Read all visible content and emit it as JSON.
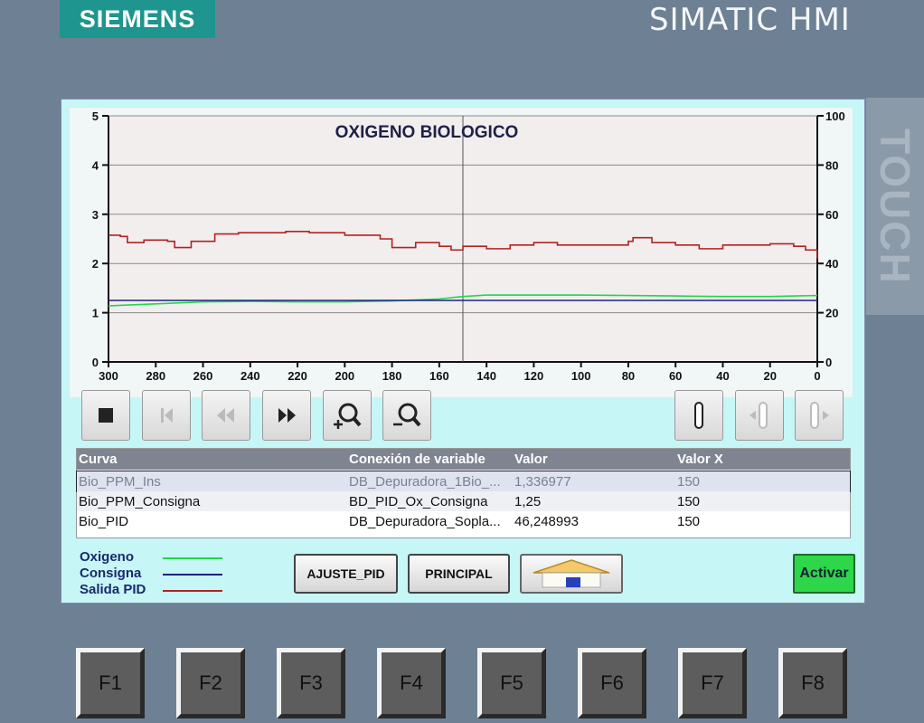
{
  "header": {
    "brand": "SIEMENS",
    "title": "SIMATIC HMI",
    "side_label": "TOUCH"
  },
  "colors": {
    "oxigeno": "#22d64a",
    "consigna": "#1a237e",
    "salida_pid": "#b22222",
    "screen_bg": "#c6f6f6"
  },
  "chart_data": {
    "type": "line",
    "title": "OXIGENO BIOLOGICO",
    "x_ticks": [
      300,
      280,
      260,
      240,
      220,
      200,
      180,
      160,
      140,
      120,
      100,
      80,
      60,
      40,
      20,
      0
    ],
    "xlim": [
      300,
      0
    ],
    "y_left_ticks": [
      "5",
      "4",
      "3",
      "2",
      "1",
      "0"
    ],
    "y_left_lim": [
      0,
      5
    ],
    "y_right_ticks": [
      "100",
      "80",
      "60",
      "40",
      "20",
      "0"
    ],
    "y_right_lim": [
      0,
      100
    ],
    "cursor_x": 150,
    "grid": true,
    "series": [
      {
        "name": "Oxigeno",
        "axis": "left",
        "color": "#22d64a",
        "x": [
          300,
          280,
          260,
          240,
          220,
          200,
          180,
          160,
          150,
          140,
          120,
          100,
          80,
          60,
          40,
          20,
          0
        ],
        "y": [
          1.14,
          1.18,
          1.22,
          1.23,
          1.22,
          1.22,
          1.24,
          1.28,
          1.33,
          1.36,
          1.36,
          1.36,
          1.35,
          1.34,
          1.33,
          1.33,
          1.35
        ]
      },
      {
        "name": "Consigna",
        "axis": "left",
        "color": "#1a237e",
        "x": [
          300,
          0
        ],
        "y": [
          1.25,
          1.25
        ]
      },
      {
        "name": "Salida PID",
        "axis": "right",
        "color": "#b22222",
        "x": [
          300,
          295,
          292,
          285,
          275,
          272,
          265,
          255,
          245,
          230,
          225,
          215,
          200,
          185,
          180,
          170,
          160,
          155,
          150,
          140,
          130,
          120,
          110,
          100,
          90,
          80,
          78,
          70,
          60,
          50,
          40,
          20,
          10,
          5,
          0
        ],
        "y": [
          51.5,
          51,
          48.5,
          49.5,
          49,
          46.5,
          49,
          52,
          52.5,
          52.5,
          53,
          52.5,
          51.5,
          50,
          46.5,
          48.5,
          47,
          45.5,
          47,
          46,
          47.5,
          48.5,
          47.5,
          47.5,
          47.5,
          49,
          50.5,
          48.5,
          47.5,
          46,
          47.5,
          48,
          47,
          45.5,
          42
        ]
      }
    ]
  },
  "toolbar": {
    "buttons": [
      "stop",
      "first",
      "rewind",
      "forward",
      "zoom-in",
      "zoom-out",
      "ruler",
      "ruler-left",
      "ruler-right"
    ]
  },
  "table": {
    "headers": [
      "Curva",
      "Conexión de variable",
      "Valor",
      "Valor X"
    ],
    "rows": [
      [
        "Bio_PPM_Ins",
        "DB_Depuradora_1Bio_...",
        "1,336977",
        "150"
      ],
      [
        "Bio_PPM_Consigna",
        "BD_PID_Ox_Consigna",
        "1,25",
        "150"
      ],
      [
        "Bio_PID",
        "DB_Depuradora_Sopla...",
        "46,248993",
        "150"
      ]
    ]
  },
  "legend": {
    "oxigeno": "Oxigeno",
    "consigna": "Consigna",
    "salida_pid": "Salida PID"
  },
  "buttons": {
    "ajuste_pid": "AJUSTE_PID",
    "principal": "PRINCIPAL",
    "home_icon": "home-icon",
    "activar": "Activar"
  },
  "fkeys": [
    "F1",
    "F2",
    "F3",
    "F4",
    "F5",
    "F6",
    "F7",
    "F8"
  ]
}
